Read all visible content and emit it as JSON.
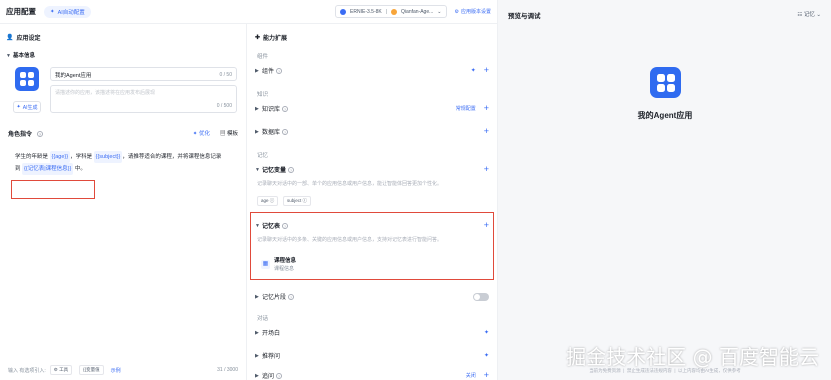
{
  "header": {
    "title": "应用配置",
    "auto_config": "AI自动配置",
    "model": "ERNIE-3.5-8K",
    "agent_select": "Qianfan-Age...",
    "settings": "应用版本设置"
  },
  "setup": {
    "title": "应用设定",
    "basic_info": "基本信息",
    "app_name": "我的Agent应用",
    "name_counter": "0 / 50",
    "desc_placeholder": "请描述你的应用，该描述将在应用发布后展现",
    "desc_counter": "0 / 500",
    "ai_generate": "AI生成",
    "role_title": "角色指令",
    "optimize": "优化",
    "template": "模板",
    "instr_1": "学生的年龄是",
    "var_age": "{{age}}",
    "instr_2": "，学科是",
    "var_subject": "{{subject}}",
    "instr_3": "，请推荐适合的课程，并将课程信息记录",
    "instr_4": "到",
    "var_table": "{{记忆表|课程信息}}",
    "instr_5": "中。",
    "footer_insert": "输入 有选项引入:",
    "footer_tool": "工具",
    "footer_var": "{{变量值",
    "footer_example": "示例",
    "footer_counter": "31 / 3000"
  },
  "ability": {
    "title": "能力扩展",
    "group_components": "组件",
    "components": "组件",
    "group_knowledge": "知识",
    "knowledge_base": "知识库",
    "kb_config": "常规配置",
    "database": "数据库",
    "group_memory": "记忆",
    "memory_var": "记忆变量",
    "memory_var_desc": "记录聊天对话中的一部、单个的应用信息或用户信息，能让智能体回答更加个性化。",
    "chip_age": "age",
    "chip_subject": "subject",
    "memory_table": "记忆表",
    "memory_table_desc": "记录聊天对话中的多条、关键的应用信息或用户信息，支持对记忆表进行智能问答。",
    "table_name": "课程信息",
    "table_sub": "课程信息",
    "memory_bank": "记忆片段",
    "group_dialog": "对话",
    "opening": "开场白",
    "recommend": "推荐问",
    "follow": "追问",
    "follow_action": "关闭"
  },
  "preview": {
    "title": "预览与调试",
    "memory": "记忆",
    "app_name": "我的Agent应用",
    "footer_1": "当前为免费资源",
    "footer_2": "禁止生成违法违规内容",
    "footer_3": "以上内容均由AI生成，仅供参考"
  },
  "watermark": "掘金技术社区 @ 百度智能云",
  "colors": {
    "accent": "#3a6cf4",
    "highlight": "#e04a3b",
    "tile": "#2f6bf0"
  }
}
